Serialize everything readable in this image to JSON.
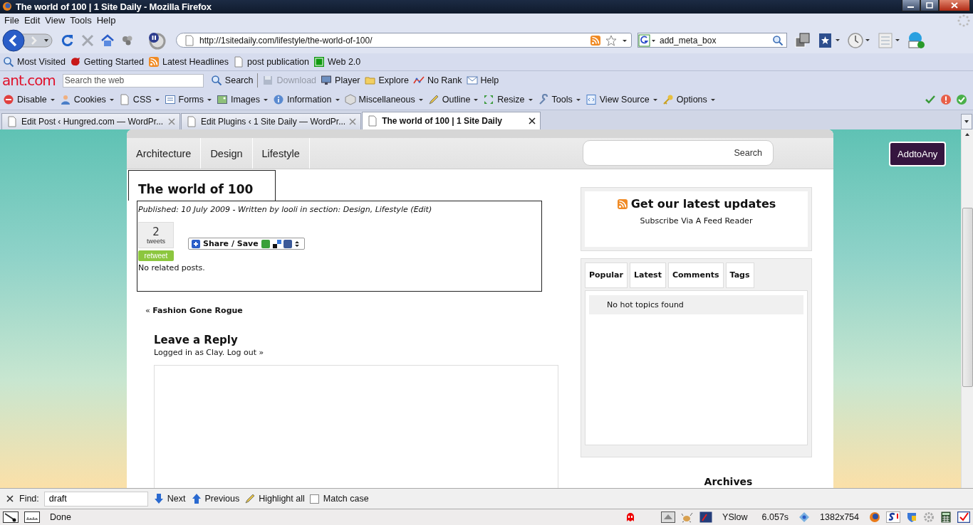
{
  "window": {
    "title": "The world of 100 | 1 Site Daily - Mozilla Firefox"
  },
  "menu": [
    "File",
    "Edit",
    "View",
    "Tools",
    "Help"
  ],
  "nav_toolbar": {
    "url": "http://1sitedaily.com/lifestyle/the-world-of-100/",
    "search_value": "add_meta_box"
  },
  "bookmarks": [
    {
      "label": "Most Visited"
    },
    {
      "label": "Getting Started"
    },
    {
      "label": "Latest Headlines"
    },
    {
      "label": "post publication"
    },
    {
      "label": "Web 2.0"
    }
  ],
  "ant_toolbar": {
    "logo": "ant.com",
    "search_placeholder": "Search the web",
    "buttons": [
      {
        "label": "Search",
        "disabled": false
      },
      {
        "label": "Download",
        "disabled": true
      },
      {
        "label": "Player",
        "disabled": false
      },
      {
        "label": "Explore",
        "disabled": false
      },
      {
        "label": "No Rank",
        "disabled": false
      },
      {
        "label": "Help",
        "disabled": false
      }
    ]
  },
  "dev_toolbar": [
    "Disable",
    "Cookies",
    "CSS",
    "Forms",
    "Images",
    "Information",
    "Miscellaneous",
    "Outline",
    "Resize",
    "Tools",
    "View Source",
    "Options"
  ],
  "tabs": [
    {
      "title": "Edit Post ‹ Hungred.com — WordPr...",
      "selected": false
    },
    {
      "title": "Edit Plugins ‹ 1 Site Daily — WordPr...",
      "selected": false
    },
    {
      "title": "The world of 100 | 1 Site Daily",
      "selected": true
    }
  ],
  "page": {
    "nav": [
      "Architecture",
      "Design",
      "Lifestyle"
    ],
    "search_button": "Search",
    "addtoany": "AddtoAny",
    "post": {
      "title": "The world of 100",
      "meta": "Published: 10 July 2009 - Written by looli in section: Design, Lifestyle (Edit)",
      "tweet_count": "2",
      "tweet_label": "tweets",
      "retweet": "retweet",
      "share": "Share / Save",
      "related": "No related posts."
    },
    "prev_link": "« **Fashion Gone Rogue**",
    "reply": {
      "heading": "Leave a Reply",
      "logged_in": "Logged in as Clay.",
      "logout": "Log out »"
    },
    "sidebar": {
      "updates_title": "Get our latest updates",
      "updates_sub": "Subscribe Via A Feed Reader",
      "tabs": [
        "Popular",
        "Latest",
        "Comments",
        "Tags"
      ],
      "tab_content": "No hot topics found",
      "archives": "Archives"
    }
  },
  "find_bar": {
    "label": "Find:",
    "value": "draft",
    "buttons": [
      "Next",
      "Previous",
      "Highlight all"
    ],
    "match_case": {
      "label": "Match case",
      "checked": false
    }
  },
  "status_bar": {
    "status": "Done",
    "yslow": "YSlow",
    "load_time": "6.057s",
    "size": "1382x754"
  }
}
